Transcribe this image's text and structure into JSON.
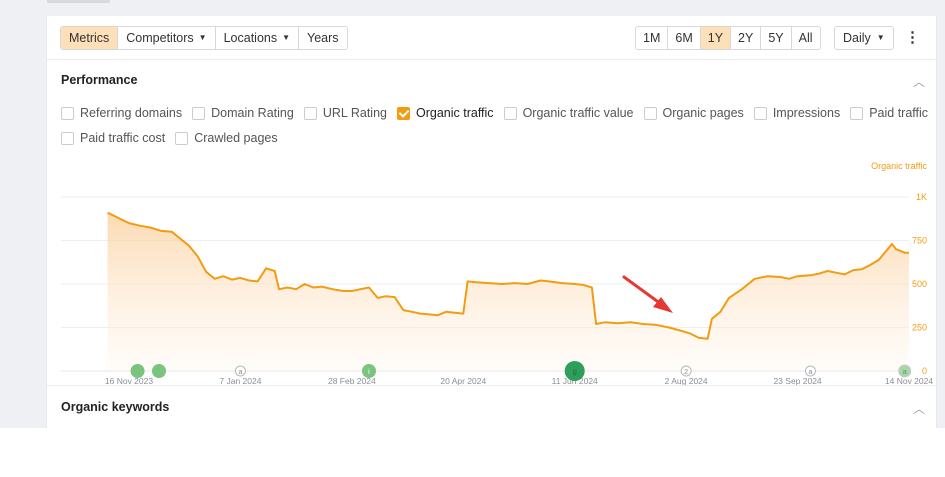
{
  "toolbar": {
    "left_buttons": [
      {
        "label": "Metrics",
        "active": true,
        "dropdown": false
      },
      {
        "label": "Competitors",
        "active": false,
        "dropdown": true
      },
      {
        "label": "Locations",
        "active": false,
        "dropdown": true
      },
      {
        "label": "Years",
        "active": false,
        "dropdown": false
      }
    ],
    "ranges": [
      {
        "label": "1M",
        "active": false
      },
      {
        "label": "6M",
        "active": false
      },
      {
        "label": "1Y",
        "active": true
      },
      {
        "label": "2Y",
        "active": false
      },
      {
        "label": "5Y",
        "active": false
      },
      {
        "label": "All",
        "active": false
      }
    ],
    "interval": "Daily",
    "more_icon": "kebab-menu-icon"
  },
  "performance": {
    "title": "Performance",
    "metrics": [
      {
        "label": "Referring domains",
        "checked": false
      },
      {
        "label": "Domain Rating",
        "checked": false
      },
      {
        "label": "URL Rating",
        "checked": false
      },
      {
        "label": "Organic traffic",
        "checked": true
      },
      {
        "label": "Organic traffic value",
        "checked": false
      },
      {
        "label": "Organic pages",
        "checked": false
      },
      {
        "label": "Impressions",
        "checked": false
      },
      {
        "label": "Paid traffic",
        "checked": false
      },
      {
        "label": "Paid traffic cost",
        "checked": false
      },
      {
        "label": "Crawled pages",
        "checked": false
      }
    ]
  },
  "chart_data": {
    "type": "area",
    "series": [
      {
        "name": "Organic traffic",
        "color": "#f39c12"
      }
    ],
    "y_ticks": [
      "0",
      "250",
      "500",
      "750",
      "1K"
    ],
    "ylim": [
      0,
      1000
    ],
    "x_ticks": [
      "16 Nov 2023",
      "7 Jan 2024",
      "28 Feb 2024",
      "20 Apr 2024",
      "11 Jun 2024",
      "2 Aug 2024",
      "23 Sep 2024",
      "14 Nov 2024"
    ],
    "x_tick_days": [
      0,
      52,
      104,
      156,
      208,
      260,
      312,
      364
    ],
    "points": [
      [
        -10,
        910
      ],
      [
        -5,
        880
      ],
      [
        0,
        850
      ],
      [
        5,
        835
      ],
      [
        10,
        825
      ],
      [
        15,
        805
      ],
      [
        20,
        800
      ],
      [
        22,
        780
      ],
      [
        28,
        720
      ],
      [
        32,
        660
      ],
      [
        36,
        570
      ],
      [
        40,
        530
      ],
      [
        44,
        545
      ],
      [
        48,
        525
      ],
      [
        52,
        535
      ],
      [
        56,
        520
      ],
      [
        60,
        515
      ],
      [
        64,
        590
      ],
      [
        68,
        575
      ],
      [
        70,
        470
      ],
      [
        74,
        480
      ],
      [
        78,
        470
      ],
      [
        82,
        500
      ],
      [
        86,
        480
      ],
      [
        90,
        485
      ],
      [
        95,
        470
      ],
      [
        100,
        460
      ],
      [
        104,
        460
      ],
      [
        108,
        470
      ],
      [
        112,
        480
      ],
      [
        116,
        420
      ],
      [
        120,
        430
      ],
      [
        124,
        425
      ],
      [
        128,
        350
      ],
      [
        132,
        340
      ],
      [
        136,
        330
      ],
      [
        140,
        325
      ],
      [
        144,
        320
      ],
      [
        148,
        340
      ],
      [
        152,
        335
      ],
      [
        156,
        330
      ],
      [
        158,
        515
      ],
      [
        162,
        510
      ],
      [
        168,
        505
      ],
      [
        174,
        500
      ],
      [
        180,
        505
      ],
      [
        186,
        500
      ],
      [
        192,
        520
      ],
      [
        196,
        515
      ],
      [
        202,
        505
      ],
      [
        208,
        500
      ],
      [
        212,
        495
      ],
      [
        216,
        480
      ],
      [
        218,
        270
      ],
      [
        222,
        280
      ],
      [
        228,
        275
      ],
      [
        234,
        280
      ],
      [
        240,
        270
      ],
      [
        246,
        265
      ],
      [
        252,
        250
      ],
      [
        258,
        230
      ],
      [
        262,
        215
      ],
      [
        266,
        190
      ],
      [
        270,
        185
      ],
      [
        272,
        300
      ],
      [
        276,
        340
      ],
      [
        280,
        420
      ],
      [
        286,
        470
      ],
      [
        292,
        530
      ],
      [
        298,
        545
      ],
      [
        304,
        540
      ],
      [
        308,
        530
      ],
      [
        312,
        545
      ],
      [
        318,
        550
      ],
      [
        322,
        560
      ],
      [
        326,
        575
      ],
      [
        330,
        565
      ],
      [
        334,
        555
      ],
      [
        338,
        580
      ],
      [
        342,
        585
      ],
      [
        346,
        610
      ],
      [
        350,
        640
      ],
      [
        354,
        700
      ],
      [
        356,
        730
      ],
      [
        358,
        700
      ],
      [
        362,
        680
      ],
      [
        364,
        680
      ]
    ],
    "event_markers": [
      {
        "day": 4,
        "type": "green",
        "label": ""
      },
      {
        "day": 14,
        "type": "green",
        "label": ""
      },
      {
        "day": 52,
        "type": "gray",
        "label": "a"
      },
      {
        "day": 112,
        "type": "green",
        "label": "i"
      },
      {
        "day": 208,
        "type": "green-large",
        "label": "g"
      },
      {
        "day": 260,
        "type": "gray",
        "label": "2"
      },
      {
        "day": 318,
        "type": "gray",
        "label": "a"
      },
      {
        "day": 362,
        "type": "green-gray",
        "label": "a"
      }
    ],
    "annotation": "red-arrow",
    "grid": true
  },
  "organic_keywords": {
    "title": "Organic keywords"
  },
  "icons": {
    "collapse": "chevron-up-icon"
  }
}
